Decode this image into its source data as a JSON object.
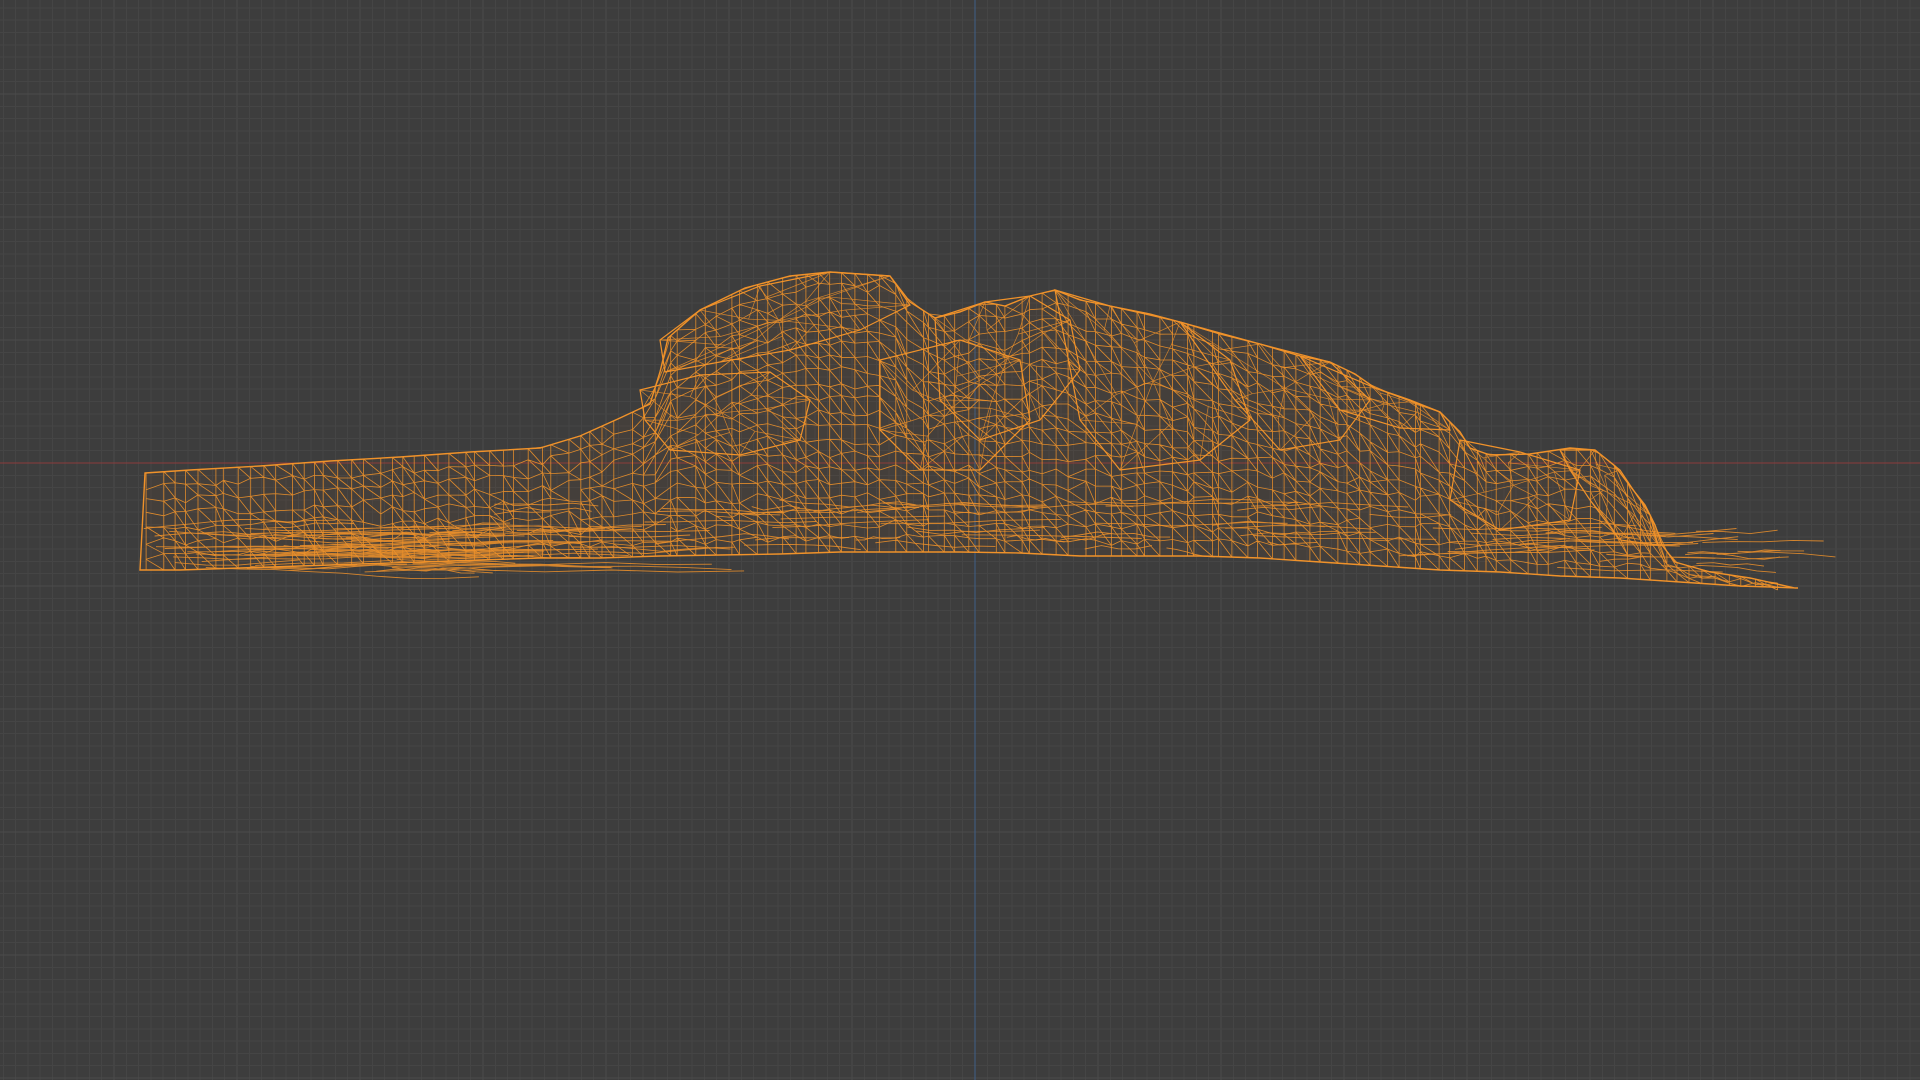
{
  "viewport": {
    "mode": "orthographic-front-wireframe",
    "object": "rock-outcrop-mesh",
    "selected": true
  },
  "colors": {
    "background": "#3d3d3d",
    "grid_minor": "#454545",
    "grid_major": "#4a4a4a",
    "x_axis": "#8a3c3c",
    "z_axis": "#3e5f86",
    "wire_selected": "#f0922a",
    "wire_fill": "#c06a1a"
  },
  "icons": {
    "mesh": "wireframe-mesh-icon"
  }
}
